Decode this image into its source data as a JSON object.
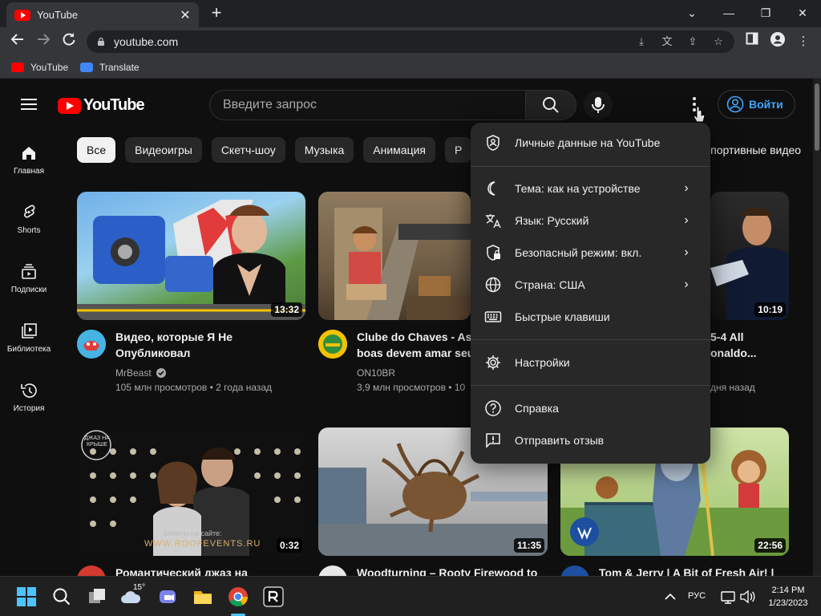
{
  "browser": {
    "tab_title": "YouTube",
    "url": "youtube.com",
    "bookmarks": [
      {
        "label": "YouTube"
      },
      {
        "label": "Translate"
      }
    ]
  },
  "header": {
    "logo_text": "YouTube",
    "search_placeholder": "Введите запрос",
    "signin_label": "Войти"
  },
  "sidebar": {
    "items": [
      {
        "label": "Главная",
        "icon": "home-icon"
      },
      {
        "label": "Shorts",
        "icon": "shorts-icon"
      },
      {
        "label": "Подписки",
        "icon": "subscriptions-icon"
      },
      {
        "label": "Библиотека",
        "icon": "library-icon"
      },
      {
        "label": "История",
        "icon": "history-icon"
      }
    ]
  },
  "chips": [
    {
      "label": "Все",
      "active": true
    },
    {
      "label": "Видеоигры"
    },
    {
      "label": "Скетч-шоу"
    },
    {
      "label": "Музыка"
    },
    {
      "label": "Анимация"
    },
    {
      "label": "Р"
    }
  ],
  "chip_last": "Спортивные видео",
  "videos": [
    {
      "title_line1": "Видео, которые Я Не",
      "title_line2": "Опубликовал",
      "channel": "MrBeast",
      "meta": "105 млн просмотров • 2 года назад",
      "duration": "13:32"
    },
    {
      "title_line1": "Clube do Chaves - As p",
      "title_line2": "boas devem amar seus",
      "channel": "ON10BR",
      "meta": "3,9 млн просмотров • 10",
      "duration": ""
    },
    {
      "title_line1": "5-4 All",
      "title_line2": "onaldo...",
      "channel": "",
      "meta": "дня назад",
      "duration": "10:19"
    },
    {
      "title_line1": "Романтический джаз на",
      "channel": "",
      "meta": "",
      "duration": "0:32",
      "overlay_text": "WWW.ROOFEVENTS.RU",
      "overlay_small": "Билеты на сайте:",
      "badge": "ДЖАЗ НА КРЫШЕ"
    },
    {
      "title_line1": "Woodturning – Rooty Firewood to",
      "channel": "",
      "meta": "",
      "duration": "11:35"
    },
    {
      "title_line1": "Tom & Jerry | A Bit of Fresh Air! |",
      "channel": "",
      "meta": "",
      "duration": "22:56"
    }
  ],
  "menu": {
    "items": [
      {
        "label": "Личные данные на YouTube",
        "icon": "shield-person-icon",
        "has_submenu": false
      },
      {
        "label": "Тема: как на устройстве",
        "icon": "moon-icon",
        "has_submenu": true
      },
      {
        "label": "Язык: Русский",
        "icon": "translate-icon",
        "has_submenu": true
      },
      {
        "label": "Безопасный режим: вкл.",
        "icon": "restricted-shield-icon",
        "has_submenu": true
      },
      {
        "label": "Страна: США",
        "icon": "globe-icon",
        "has_submenu": true
      },
      {
        "label": "Быстрые клавиши",
        "icon": "keyboard-icon",
        "has_submenu": false
      },
      {
        "label": "Настройки",
        "icon": "gear-icon",
        "has_submenu": false
      },
      {
        "label": "Справка",
        "icon": "help-icon",
        "has_submenu": false
      },
      {
        "label": "Отправить отзыв",
        "icon": "feedback-icon",
        "has_submenu": false
      }
    ],
    "chevron": "›"
  },
  "taskbar": {
    "weather_temp": "15°",
    "language": "РУС",
    "time": "2:14 PM",
    "date": "1/23/2023"
  },
  "colors": {
    "accent_red": "#ff0000",
    "link_blue": "#3ea6ff",
    "bg": "#0f0f0f",
    "menu_bg": "#282828"
  }
}
